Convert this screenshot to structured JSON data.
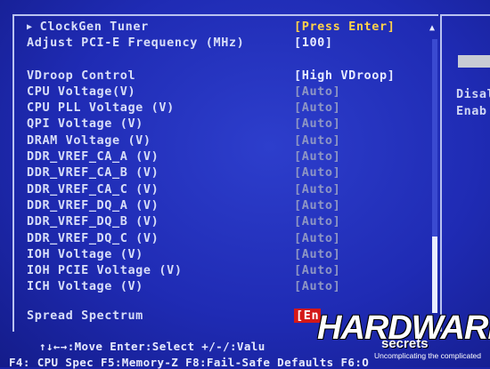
{
  "settings": [
    {
      "label": "ClockGen Tuner",
      "value": "[Press Enter]",
      "style": "yellow",
      "submenu": true
    },
    {
      "label": "Adjust PCI-E Frequency (MHz)",
      "value": "[100]",
      "style": "white"
    },
    {
      "label": "VDroop Control",
      "value": "[High VDroop]",
      "style": "white"
    },
    {
      "label": "CPU Voltage(V)",
      "value": "[Auto]",
      "style": "auto"
    },
    {
      "label": "CPU PLL Voltage (V)",
      "value": "[Auto]",
      "style": "auto"
    },
    {
      "label": "QPI Voltage (V)",
      "value": "[Auto]",
      "style": "auto"
    },
    {
      "label": "DRAM Voltage (V)",
      "value": "[Auto]",
      "style": "auto"
    },
    {
      "label": "DDR_VREF_CA_A (V)",
      "value": "[Auto]",
      "style": "auto"
    },
    {
      "label": "DDR_VREF_CA_B (V)",
      "value": "[Auto]",
      "style": "auto"
    },
    {
      "label": "DDR_VREF_CA_C (V)",
      "value": "[Auto]",
      "style": "auto"
    },
    {
      "label": "DDR_VREF_DQ_A (V)",
      "value": "[Auto]",
      "style": "auto"
    },
    {
      "label": "DDR_VREF_DQ_B (V)",
      "value": "[Auto]",
      "style": "auto"
    },
    {
      "label": "DDR_VREF_DQ_C (V)",
      "value": "[Auto]",
      "style": "auto"
    },
    {
      "label": "IOH Voltage (V)",
      "value": "[Auto]",
      "style": "auto"
    },
    {
      "label": "IOH PCIE Voltage (V)",
      "value": "[Auto]",
      "style": "auto"
    },
    {
      "label": "ICH Voltage (V)",
      "value": "[Auto]",
      "style": "auto"
    },
    {
      "label": "Spread Spectrum",
      "value": "[En",
      "style": "red"
    }
  ],
  "help": {
    "line1": "Disal",
    "line2": "Enab"
  },
  "footer": {
    "line1": "↑↓←→:Move  Enter:Select  +/-/:Valu",
    "line2": "F4: CPU Spec  F5:Memory-Z  F8:Fail-Safe Defaults  F6:O"
  },
  "watermark": {
    "main": "HARDWARE",
    "sub": "secrets",
    "tagline": "Uncomplicating the complicated"
  },
  "colors": {
    "background": "#1f2bb4",
    "value_yellow": "#ffd24a",
    "value_auto": "#8e96c4",
    "highlight_red": "#d41818"
  },
  "icons": {
    "submenu": "triangle-right-icon",
    "scroll_up": "triangle-up-icon"
  }
}
